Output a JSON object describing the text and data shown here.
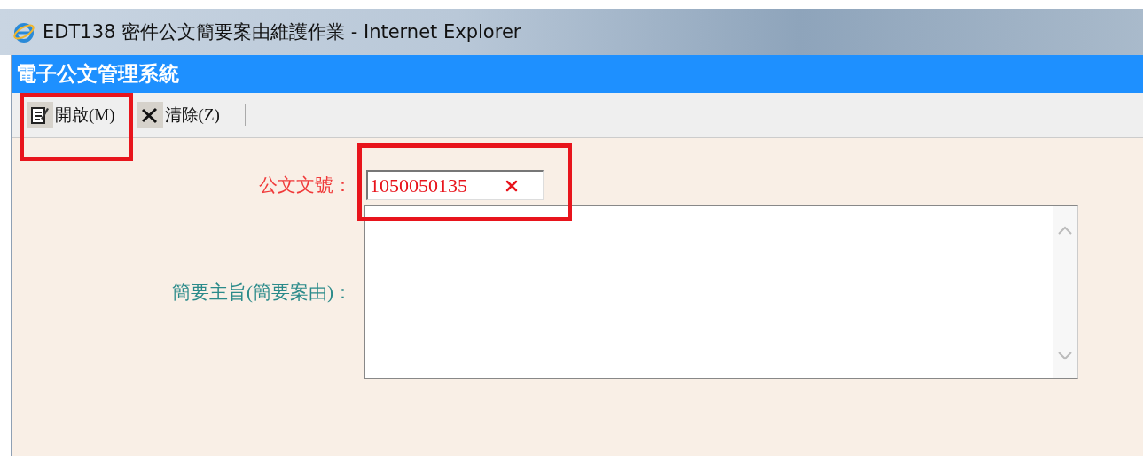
{
  "window": {
    "title": "EDT138 密件公文簡要案由維護作業 - Internet Explorer"
  },
  "app_header": {
    "title": "電子公文管理系統"
  },
  "toolbar": {
    "buttons": [
      {
        "kind": "open",
        "label": "開啟(M)",
        "highlighted": true
      },
      {
        "kind": "clear",
        "label": "清除(Z)",
        "highlighted": false
      }
    ]
  },
  "form": {
    "doc_number": {
      "label": "公文文號：",
      "value": "1050050135",
      "highlighted": true
    },
    "summary": {
      "label": "簡要主旨(簡要案由)："
    }
  }
}
